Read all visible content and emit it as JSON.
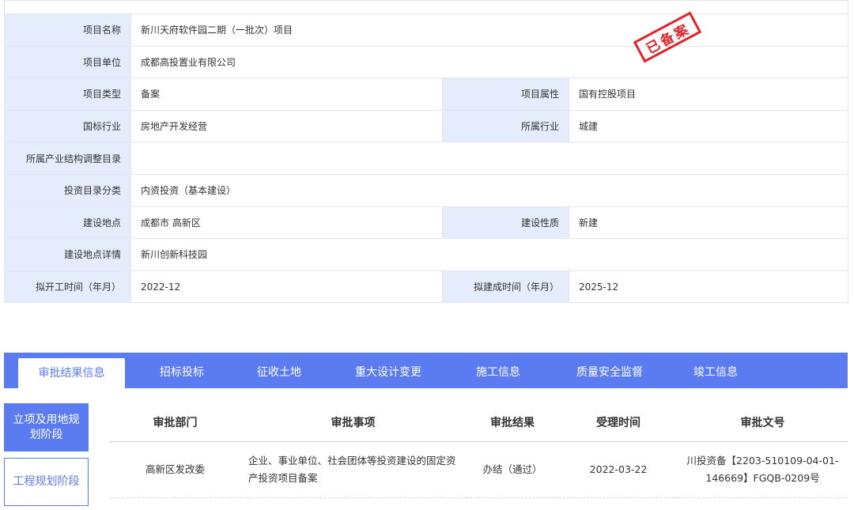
{
  "stamp": "已备案",
  "info_rows": [
    {
      "label": "项目名称",
      "value": "新川天府软件园二期（一批次）项目"
    },
    {
      "label": "项目单位",
      "value": "成都高投置业有限公司"
    },
    {
      "label": "项目类型",
      "value": "备案",
      "label2": "项目属性",
      "value2": "国有控股项目"
    },
    {
      "label": "国标行业",
      "value": "房地产开发经营",
      "label2": "所属行业",
      "value2": "城建"
    },
    {
      "label": "所属产业结构调整目录",
      "value": ""
    },
    {
      "label": "投资目录分类",
      "value": "内资投资（基本建设）"
    },
    {
      "label": "建设地点",
      "value": "成都市 高新区",
      "label2": "建设性质",
      "value2": "新建"
    },
    {
      "label": "建设地点详情",
      "value": "新川创新科技园"
    },
    {
      "label": "拟开工时间（年月）",
      "value": "2022-12",
      "label2": "拟建成时间（年月）",
      "value2": "2025-12"
    }
  ],
  "tabs": [
    "审批结果信息",
    "招标投标",
    "征收土地",
    "重大设计变更",
    "施工信息",
    "质量安全监督",
    "竣工信息"
  ],
  "side": {
    "active": "立项及用地规划阶段",
    "inactive": "工程规划阶段"
  },
  "result_headers": [
    "审批部门",
    "审批事项",
    "审批结果",
    "受理时间",
    "审批文号"
  ],
  "result_rows": [
    {
      "dept": "高新区发改委",
      "item": "企业、事业单位、社会团体等投资建设的固定资产投资项目备案",
      "result": "办结（通过）",
      "date": "2022-03-22",
      "doc_no": "川投资备【2203-510109-04-01-146669】FGQB-0209号"
    }
  ]
}
